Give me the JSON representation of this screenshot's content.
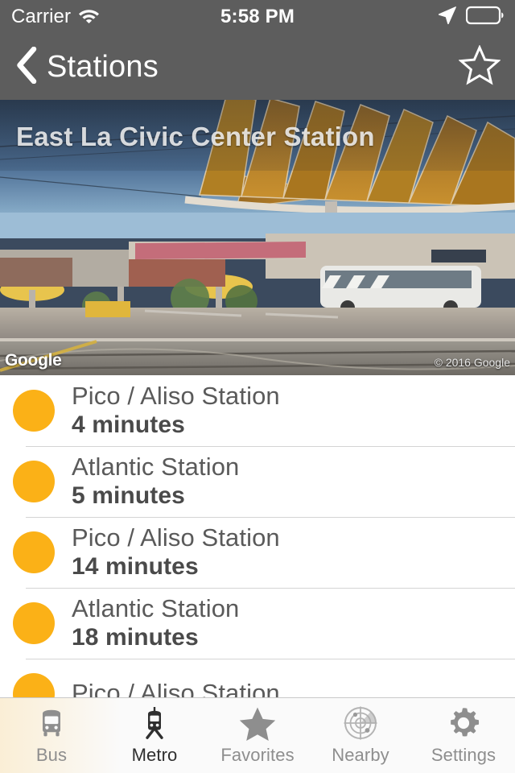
{
  "status_bar": {
    "carrier": "Carrier",
    "wifi_icon": "wifi-icon",
    "time": "5:58 PM",
    "location_icon": "location-arrow-icon",
    "battery_icon": "battery-icon"
  },
  "nav_bar": {
    "back_icon": "chevron-left-icon",
    "back_label": "Stations",
    "favorite_icon": "star-outline-icon"
  },
  "hero": {
    "station_title": "East La Civic Center Station",
    "map_provider": "Google",
    "copyright": "© 2016 Google"
  },
  "departures": [
    {
      "dot": "line-marker",
      "station": "Pico / Aliso Station",
      "eta": "4 minutes"
    },
    {
      "dot": "line-marker",
      "station": "Atlantic Station",
      "eta": "5 minutes"
    },
    {
      "dot": "line-marker",
      "station": "Pico / Aliso Station",
      "eta": "14 minutes"
    },
    {
      "dot": "line-marker",
      "station": "Atlantic Station",
      "eta": "18 minutes"
    },
    {
      "dot": "line-marker",
      "station": "Pico / Aliso Station",
      "eta": ""
    }
  ],
  "tab_bar": {
    "tabs": [
      {
        "label": "Bus",
        "icon": "bus-icon",
        "active": false
      },
      {
        "label": "Metro",
        "icon": "tram-icon",
        "active": true
      },
      {
        "label": "Favorites",
        "icon": "star-filled-icon",
        "active": false
      },
      {
        "label": "Nearby",
        "icon": "radar-icon",
        "active": false
      },
      {
        "label": "Settings",
        "icon": "gear-icon",
        "active": false
      }
    ]
  },
  "colors": {
    "bar_gray": "#5d5d5d",
    "dot_orange": "#fbb117",
    "text_gray": "#5a5a5a",
    "tab_inactive": "#8e8e8e",
    "tab_active": "#2f2f2f"
  }
}
